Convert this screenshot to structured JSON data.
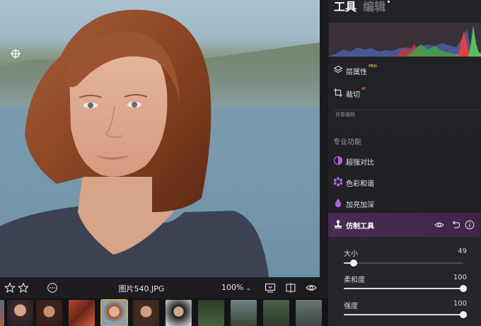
{
  "panel": {
    "tabs": [
      {
        "label": "工具",
        "active": true
      },
      {
        "label": "编辑",
        "active": false
      }
    ],
    "items": [
      {
        "label": "层属性",
        "badge": "PRO",
        "icon": "layers-icon"
      },
      {
        "label": "裁切",
        "badge": "AI",
        "icon": "crop-icon"
      }
    ],
    "partial_label": "肖像编辑",
    "section_label": "专业功能",
    "pro_tools": [
      {
        "label": "超强对比",
        "icon": "contrast-icon"
      },
      {
        "label": "色彩和谐",
        "icon": "color-harmony-icon"
      },
      {
        "label": "加亮加深",
        "icon": "dodge-burn-icon"
      }
    ],
    "active_tool": {
      "label": "仿制工具",
      "icon": "clone-stamp-icon",
      "actions": [
        "eye-icon",
        "undo-icon",
        "info-icon"
      ]
    },
    "sliders": [
      {
        "label": "大小",
        "value": "49",
        "fraction": 0.08
      },
      {
        "label": "柔和度",
        "value": "100",
        "fraction": 1.0
      },
      {
        "label": "强度",
        "value": "100",
        "fraction": 1.0
      }
    ]
  },
  "toolbar": {
    "filename": "图片540.JPG",
    "zoom": "100%",
    "left_icons": [
      "star-outline-icon",
      "star-outline-icon",
      "more-options-icon"
    ],
    "right_icons": [
      "compare-view-icon",
      "split-view-icon",
      "eye-icon"
    ]
  },
  "filmstrip": {
    "selected_index": 4
  },
  "colors": {
    "accent": "#b463e0",
    "selected_thumb_border": "#d9a83a",
    "pro_badge": "#d9a83a",
    "ai_badge": "#e06b3c"
  }
}
